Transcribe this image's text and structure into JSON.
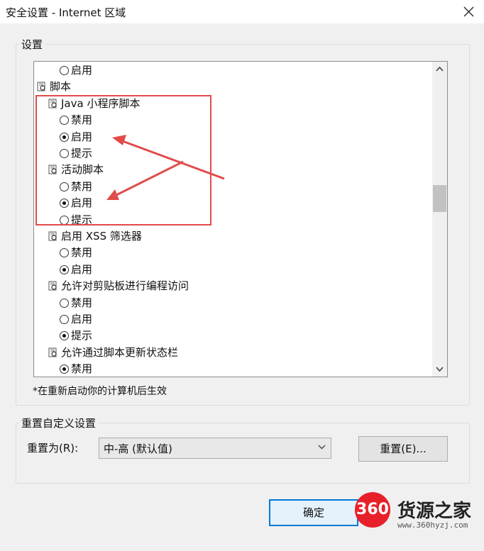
{
  "window": {
    "title": "安全设置 - Internet 区域"
  },
  "settings": {
    "label": "设置",
    "rows": [
      {
        "type": "option",
        "label": "启用",
        "checked": false
      },
      {
        "type": "category",
        "label": "脚本"
      },
      {
        "type": "setting",
        "label": "Java 小程序脚本"
      },
      {
        "type": "option",
        "label": "禁用",
        "checked": false
      },
      {
        "type": "option",
        "label": "启用",
        "checked": true
      },
      {
        "type": "option",
        "label": "提示",
        "checked": false
      },
      {
        "type": "setting",
        "label": "活动脚本"
      },
      {
        "type": "option",
        "label": "禁用",
        "checked": false
      },
      {
        "type": "option",
        "label": "启用",
        "checked": true
      },
      {
        "type": "option",
        "label": "提示",
        "checked": false
      },
      {
        "type": "setting",
        "label": "启用 XSS 筛选器"
      },
      {
        "type": "option",
        "label": "禁用",
        "checked": false
      },
      {
        "type": "option",
        "label": "启用",
        "checked": true
      },
      {
        "type": "setting",
        "label": "允许对剪贴板进行编程访问"
      },
      {
        "type": "option",
        "label": "禁用",
        "checked": false
      },
      {
        "type": "option",
        "label": "启用",
        "checked": false
      },
      {
        "type": "option",
        "label": "提示",
        "checked": true
      },
      {
        "type": "setting",
        "label": "允许通过脚本更新状态栏"
      },
      {
        "type": "option",
        "label": "禁用",
        "checked": true
      }
    ],
    "note": "*在重新启动你的计算机后生效"
  },
  "reset": {
    "group_label": "重置自定义设置",
    "reset_to_label": "重置为(R):",
    "selected_level": "中-高 (默认值)",
    "reset_button": "重置(E)..."
  },
  "footer": {
    "ok_button": "确定"
  },
  "watermark": {
    "badge": "360",
    "name": "货源之家",
    "url": "www.360hyzj.com"
  },
  "colors": {
    "annotation_red": "#e14b4b",
    "accent_blue": "#0078d7"
  }
}
